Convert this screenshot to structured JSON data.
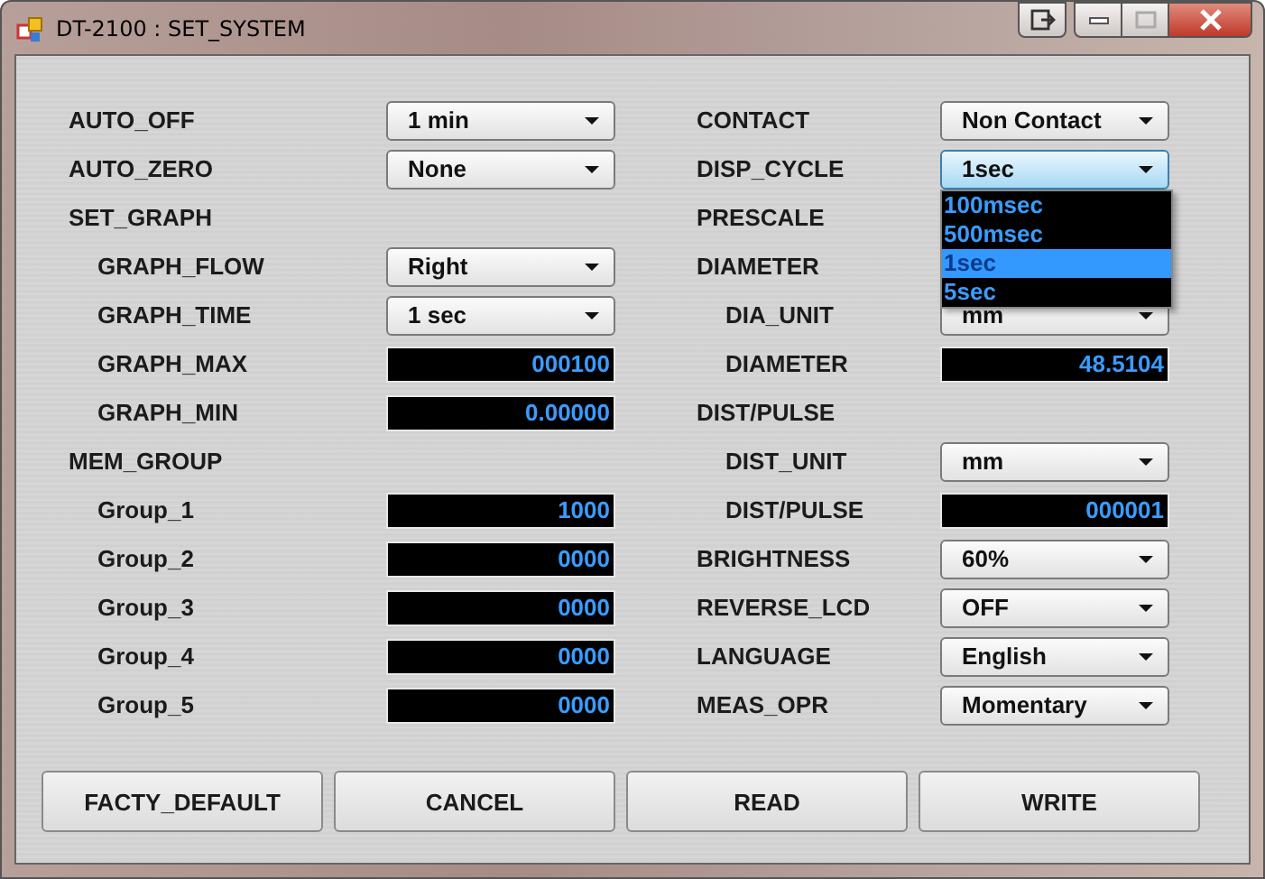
{
  "window": {
    "title": "DT-2100 : SET_SYSTEM"
  },
  "columns": [
    [
      {
        "label": "AUTO_OFF",
        "kind": "select",
        "value": "1 min"
      },
      {
        "label": "AUTO_ZERO",
        "kind": "select",
        "value": "None"
      },
      {
        "label": "SET_GRAPH",
        "kind": "label",
        "children": [
          {
            "label": "GRAPH_FLOW",
            "kind": "select",
            "value": "Right"
          },
          {
            "label": "GRAPH_TIME",
            "kind": "select",
            "value": "1 sec"
          },
          {
            "label": "GRAPH_MAX",
            "kind": "number",
            "value": "000100"
          },
          {
            "label": "GRAPH_MIN",
            "kind": "number",
            "value": "0.00000"
          }
        ]
      },
      {
        "label": "MEM_GROUP",
        "kind": "label",
        "children": [
          {
            "label": "Group_1",
            "kind": "number",
            "value": "1000"
          },
          {
            "label": "Group_2",
            "kind": "number",
            "value": "0000"
          },
          {
            "label": "Group_3",
            "kind": "number",
            "value": "0000"
          },
          {
            "label": "Group_4",
            "kind": "number",
            "value": "0000"
          },
          {
            "label": "Group_5",
            "kind": "number",
            "value": "0000"
          }
        ]
      }
    ],
    [
      {
        "label": "CONTACT",
        "kind": "select",
        "value": "Non Contact"
      },
      {
        "label": "DISP_CYCLE",
        "kind": "select",
        "value": "1sec",
        "open": true,
        "options": [
          {
            "label": "100msec",
            "selected": false
          },
          {
            "label": "500msec",
            "selected": false
          },
          {
            "label": "1sec",
            "selected": true
          },
          {
            "label": "5sec",
            "selected": false
          }
        ]
      },
      {
        "label": "PRESCALE",
        "kind": "label"
      },
      {
        "label": "DIAMETER",
        "kind": "label",
        "children": [
          {
            "label": "DIA_UNIT",
            "kind": "select",
            "value": "mm"
          },
          {
            "label": "DIAMETER",
            "kind": "number",
            "value": "48.5104"
          }
        ]
      },
      {
        "label": "DIST/PULSE",
        "kind": "label",
        "children": [
          {
            "label": "DIST_UNIT",
            "kind": "select",
            "value": "mm"
          },
          {
            "label": "DIST/PULSE",
            "kind": "number",
            "value": "000001"
          }
        ]
      },
      {
        "label": "BRIGHTNESS",
        "kind": "select",
        "value": "60%"
      },
      {
        "label": "REVERSE_LCD",
        "kind": "select",
        "value": "OFF"
      },
      {
        "label": "LANGUAGE",
        "kind": "select",
        "value": "English"
      },
      {
        "label": "MEAS_OPR",
        "kind": "select",
        "value": "Momentary"
      }
    ]
  ],
  "buttons": [
    "FACTY_DEFAULT",
    "CANCEL",
    "READ",
    "WRITE"
  ]
}
